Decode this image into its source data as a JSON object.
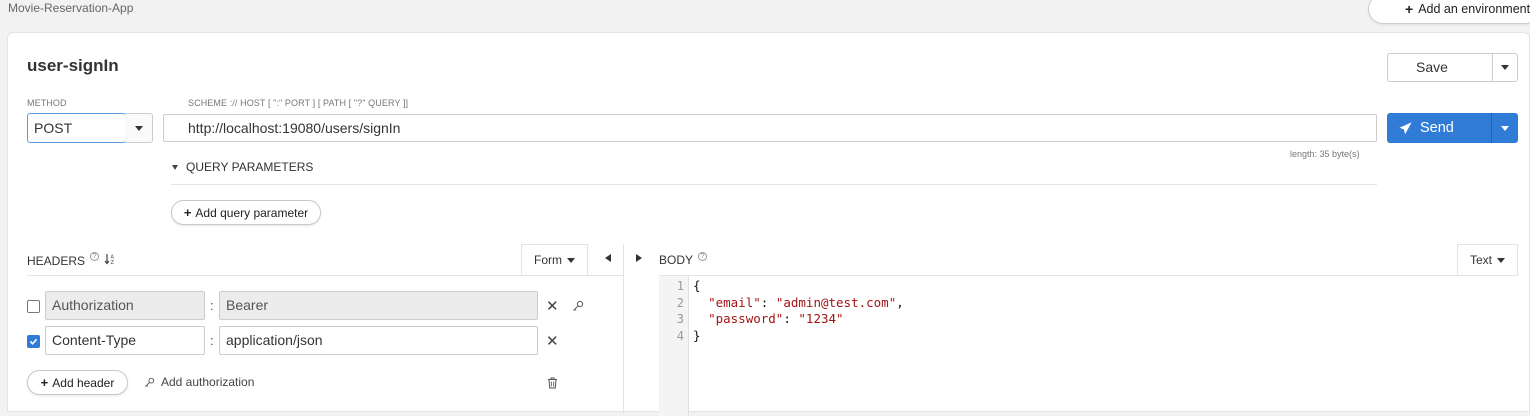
{
  "breadcrumb": "Movie-Reservation-App",
  "env_button": {
    "label": "Add an environment"
  },
  "request": {
    "title": "user-signIn",
    "save_label": "Save",
    "method_label": "METHOD",
    "scheme_label": "SCHEME :// HOST [ \":\" PORT ] [ PATH [ \"?\" QUERY ]]",
    "method": "POST",
    "url": "http://localhost:19080/users/signIn",
    "send_label": "Send",
    "length": "length: 35 byte(s)"
  },
  "query": {
    "title": "QUERY PARAMETERS",
    "add_label": "Add query parameter"
  },
  "headers": {
    "title": "HEADERS",
    "mode": "Form",
    "rows": [
      {
        "checked": false,
        "key": "Authorization",
        "value": "Bearer"
      },
      {
        "checked": true,
        "key": "Content-Type",
        "value": "application/json"
      }
    ],
    "add_header_label": "Add header",
    "add_auth_label": "Add authorization"
  },
  "body": {
    "title": "BODY",
    "mode": "Text",
    "line_numbers": [
      "1",
      "2",
      "3",
      "4"
    ],
    "lines": {
      "open": "{",
      "email_key": "\"email\"",
      "email_value": "\"admin@test.com\"",
      "password_key": "\"password\"",
      "password_value": "\"1234\"",
      "close": "}"
    }
  },
  "colors": {
    "accent": "#2f7bd6",
    "string": "#a31515"
  }
}
